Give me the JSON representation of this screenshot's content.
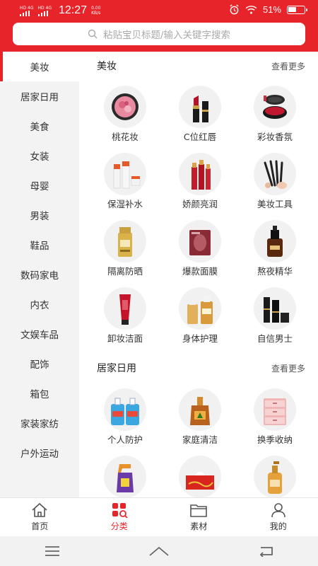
{
  "status_bar": {
    "carrier1": "HD 4G",
    "carrier2": "HD 4G",
    "time": "12:27",
    "speed_value": "0.00",
    "speed_unit": "KB/s",
    "battery": "51%",
    "battery_level": 0.51
  },
  "search": {
    "placeholder": "粘贴宝贝标题/输入关键字搜索",
    "icon": "search-icon"
  },
  "sidebar": {
    "items": [
      {
        "label": "美妆",
        "active": true
      },
      {
        "label": "居家日用"
      },
      {
        "label": "美食"
      },
      {
        "label": "女装"
      },
      {
        "label": "母婴"
      },
      {
        "label": "男装"
      },
      {
        "label": "鞋品"
      },
      {
        "label": "数码家电"
      },
      {
        "label": "内衣"
      },
      {
        "label": "文娱车品"
      },
      {
        "label": "配饰"
      },
      {
        "label": "箱包"
      },
      {
        "label": "家装家纺"
      },
      {
        "label": "户外运动"
      }
    ]
  },
  "sections": [
    {
      "title": "美妆",
      "more": "查看更多",
      "items": [
        {
          "label": "桃花妆",
          "icon": "blush-compact-icon"
        },
        {
          "label": "C位红唇",
          "icon": "lipstick-icon"
        },
        {
          "label": "彩妆香氛",
          "icon": "perfume-compact-icon"
        },
        {
          "label": "保湿补水",
          "icon": "moisturizer-bottles-icon"
        },
        {
          "label": "娇颜亮润",
          "icon": "toner-bottles-icon"
        },
        {
          "label": "美妆工具",
          "icon": "makeup-brushes-icon"
        },
        {
          "label": "隔离防晒",
          "icon": "sunscreen-icon"
        },
        {
          "label": "爆款面膜",
          "icon": "face-mask-icon"
        },
        {
          "label": "熬夜精华",
          "icon": "serum-bottle-icon"
        },
        {
          "label": "卸妆洁面",
          "icon": "cleanser-tube-icon"
        },
        {
          "label": "身体护理",
          "icon": "body-lotion-icon"
        },
        {
          "label": "自信男士",
          "icon": "mens-skincare-icon"
        }
      ]
    },
    {
      "title": "居家日用",
      "more": "查看更多",
      "items": [
        {
          "label": "个人防护",
          "icon": "hand-soap-icon"
        },
        {
          "label": "家庭清洁",
          "icon": "disinfectant-icon"
        },
        {
          "label": "换季收纳",
          "icon": "storage-drawers-icon"
        },
        {
          "label": "",
          "icon": "cleaner-spray-icon"
        },
        {
          "label": "",
          "icon": "tissue-box-icon"
        },
        {
          "label": "",
          "icon": "shampoo-bottle-icon"
        }
      ]
    }
  ],
  "tabbar": {
    "items": [
      {
        "label": "首页",
        "icon": "home-icon"
      },
      {
        "label": "分类",
        "icon": "category-icon",
        "active": true
      },
      {
        "label": "素材",
        "icon": "folder-icon"
      },
      {
        "label": "我的",
        "icon": "profile-icon"
      }
    ]
  },
  "colors": {
    "brand": "#e8242b",
    "sidebar_bg": "#f3f3f3",
    "thumb_bg": "#f1f1f1"
  }
}
